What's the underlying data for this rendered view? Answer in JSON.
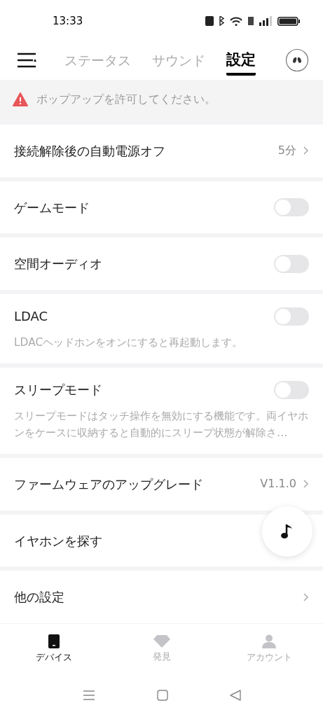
{
  "status_bar": {
    "time": "13:33"
  },
  "tabs": [
    {
      "label": "ステータス",
      "selected": false
    },
    {
      "label": "サウンド",
      "selected": false
    },
    {
      "label": "設定",
      "selected": true
    }
  ],
  "banner": {
    "text": "ポップアップを許可してください。"
  },
  "settings": [
    {
      "kind": "value",
      "label": "接続解除後の自動電源オフ",
      "value": "5分"
    },
    {
      "kind": "toggle",
      "label": "ゲームモード",
      "on": false
    },
    {
      "kind": "toggle",
      "label": "空間オーディオ",
      "on": false
    },
    {
      "kind": "toggle",
      "label": "LDAC",
      "on": false,
      "description": "LDACヘッドホンをオンにすると再起動します。"
    },
    {
      "kind": "toggle",
      "label": "スリープモード",
      "on": false,
      "description": "スリープモードはタッチ操作を無効にする機能です。両イヤホンをケースに収納すると自動的にスリープ状態が解除さ…"
    },
    {
      "kind": "value",
      "label": "ファームウェアのアップグレード",
      "value": "V1.1.0"
    },
    {
      "kind": "plain",
      "label": "イヤホンを探す"
    },
    {
      "kind": "value",
      "label": "他の設定"
    }
  ],
  "bottom_nav": [
    {
      "kind": "device",
      "label": "デバイス",
      "selected": true
    },
    {
      "kind": "discover",
      "label": "発見",
      "selected": false
    },
    {
      "kind": "account",
      "label": "アカウント",
      "selected": false
    }
  ]
}
